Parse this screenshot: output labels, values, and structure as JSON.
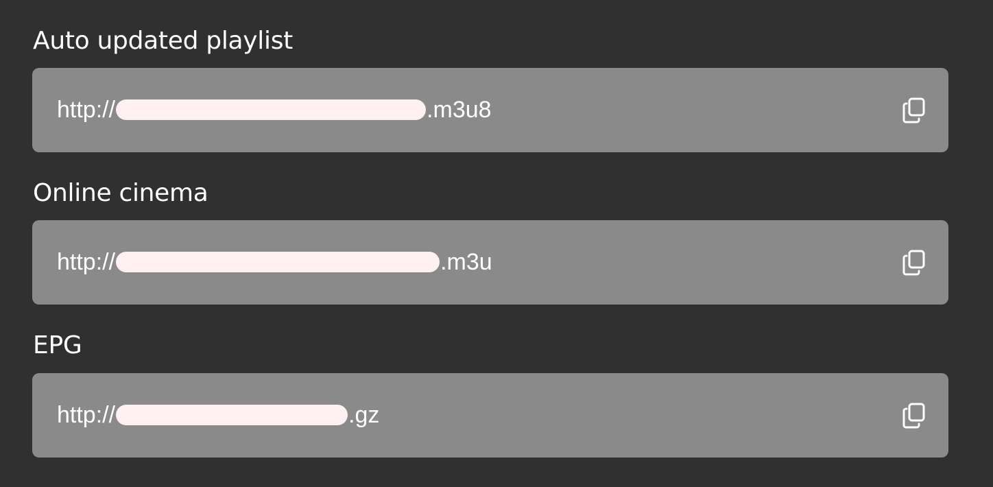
{
  "sections": [
    {
      "title": "Auto updated playlist",
      "url_prefix": "http://",
      "url_suffix": ".m3u8",
      "copy_icon": "copy-icon"
    },
    {
      "title": "Online cinema",
      "url_prefix": "http://",
      "url_suffix": ".m3u",
      "copy_icon": "copy-icon"
    },
    {
      "title": "EPG",
      "url_prefix": "http://",
      "url_suffix": ".gz",
      "copy_icon": "copy-icon"
    }
  ],
  "colors": {
    "background": "#303030",
    "box": "#8a8a8a",
    "text": "#ffffff",
    "redaction": "#fff0f1"
  }
}
